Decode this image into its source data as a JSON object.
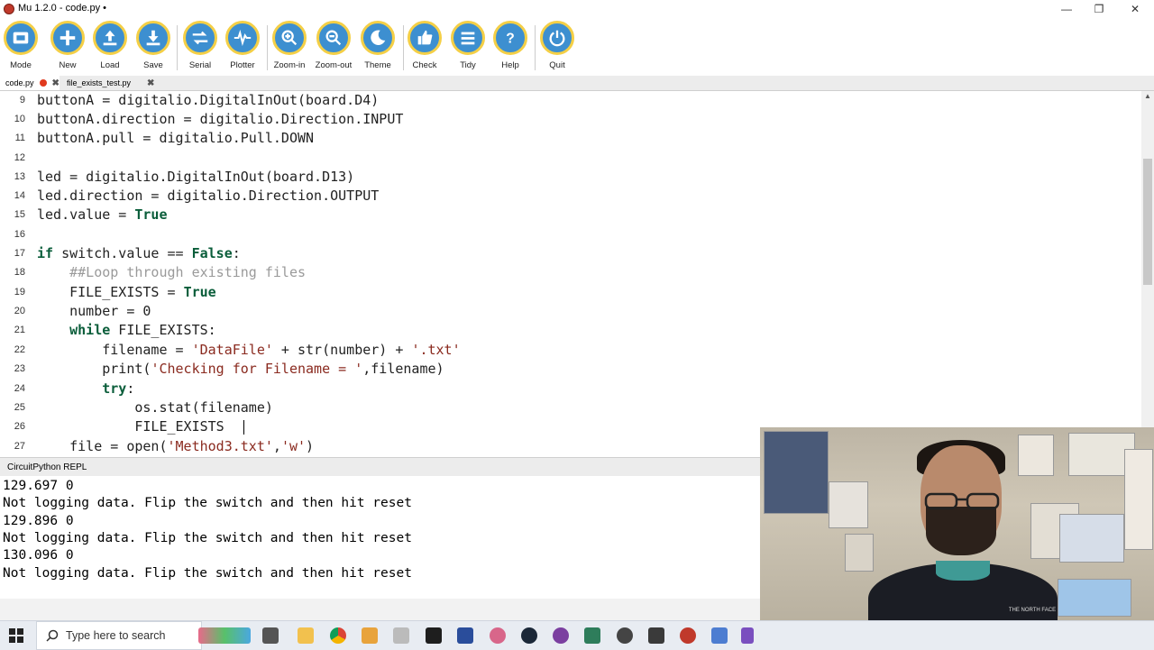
{
  "window": {
    "title": "Mu 1.2.0 - code.py •",
    "minimize_glyph": "—",
    "maximize_glyph": "❐",
    "close_glyph": "✕"
  },
  "toolbar": {
    "buttons": [
      {
        "label": "Mode",
        "icon": "mode-icon"
      },
      {
        "label": "New",
        "icon": "plus-icon"
      },
      {
        "label": "Load",
        "icon": "upload-icon"
      },
      {
        "label": "Save",
        "icon": "download-icon"
      },
      {
        "label": "Serial",
        "icon": "arrows-swap-icon"
      },
      {
        "label": "Plotter",
        "icon": "pulse-icon"
      },
      {
        "label": "Zoom-in",
        "icon": "zoom-in-icon"
      },
      {
        "label": "Zoom-out",
        "icon": "zoom-out-icon"
      },
      {
        "label": "Theme",
        "icon": "moon-icon"
      },
      {
        "label": "Check",
        "icon": "thumbs-up-icon"
      },
      {
        "label": "Tidy",
        "icon": "lines-icon"
      },
      {
        "label": "Help",
        "icon": "question-icon"
      },
      {
        "label": "Quit",
        "icon": "power-icon"
      }
    ],
    "accent_color": "#3d8fd0",
    "ring_color": "#f4cf46"
  },
  "tabs": [
    {
      "label": "code.py",
      "modified": true,
      "close_glyph": "✖"
    },
    {
      "label": "file_exists_test.py",
      "modified": false,
      "close_glyph": "✖"
    }
  ],
  "editor": {
    "lines": [
      {
        "num": "9",
        "text": "buttonA = digitalio.DigitalInOut(board.D4)"
      },
      {
        "num": "10",
        "text": "buttonA.direction = digitalio.Direction.INPUT"
      },
      {
        "num": "11",
        "text": "buttonA.pull = digitalio.Pull.DOWN"
      },
      {
        "num": "12",
        "text": ""
      },
      {
        "num": "13",
        "text": "led = digitalio.DigitalInOut(board.D13)"
      },
      {
        "num": "14",
        "text": "led.direction = digitalio.Direction.OUTPUT"
      },
      {
        "num": "15",
        "text": "led.value = True"
      },
      {
        "num": "16",
        "text": ""
      },
      {
        "num": "17",
        "text": "if switch.value == False:"
      },
      {
        "num": "18",
        "text": "    ##Loop through existing files"
      },
      {
        "num": "19",
        "text": "    FILE_EXISTS = True"
      },
      {
        "num": "20",
        "text": "    number = 0"
      },
      {
        "num": "21",
        "text": "    while FILE_EXISTS:"
      },
      {
        "num": "22",
        "text": "        filename = 'DataFile' + str(number) + '.txt'"
      },
      {
        "num": "23",
        "text": "        print('Checking for Filename = ',filename)"
      },
      {
        "num": "24",
        "text": "        try:"
      },
      {
        "num": "25",
        "text": "            os.stat(filename)"
      },
      {
        "num": "26",
        "text": "            FILE_EXISTS"
      },
      {
        "num": "27",
        "text": "    file = open('Method3.txt','w')"
      }
    ]
  },
  "repl": {
    "title": "CircuitPython REPL",
    "lines": [
      "129.697 0",
      "Not logging data. Flip the switch and then hit reset",
      "129.896 0",
      "Not logging data. Flip the switch and then hit reset",
      "130.096 0",
      "Not logging data. Flip the switch and then hit reset"
    ]
  },
  "taskbar": {
    "search_placeholder": "Type here to search",
    "apps": [
      "task-view-icon",
      "file-explorer-icon",
      "chrome-icon",
      "app-icon",
      "app-icon",
      "terminal-icon",
      "app-icon",
      "app-icon",
      "steam-icon",
      "app-icon",
      "app-icon",
      "app-icon",
      "app-icon",
      "app-icon",
      "app-icon",
      "app-icon"
    ]
  },
  "webcam": {
    "shirt_print": "THE NORTH FACE"
  }
}
